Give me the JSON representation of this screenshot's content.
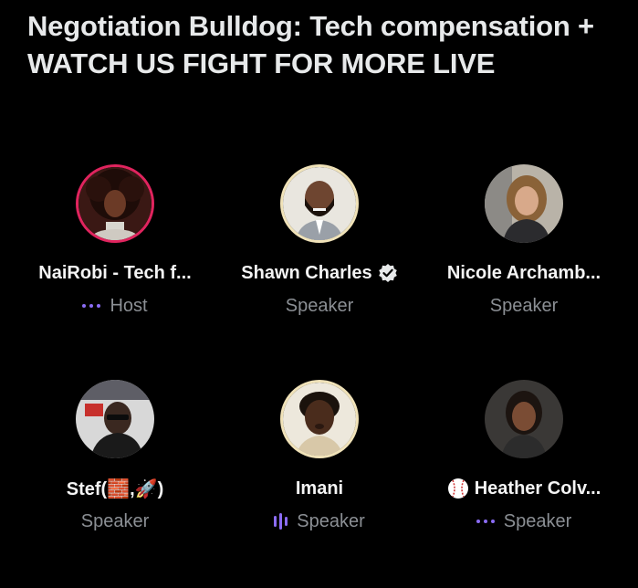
{
  "space": {
    "title": "Negotiation Bulldog: Tech compensation + WATCH US FIGHT FOR MORE LIVE"
  },
  "participants": [
    {
      "name": "NaiRobi - Tech f...",
      "role": "Host",
      "ring_color": "#e0245e",
      "indicator": "dots-icon"
    },
    {
      "name": "Shawn Charles",
      "role": "Speaker",
      "ring_color": "#f0e2b8",
      "badge": "verified-badge-icon"
    },
    {
      "name": "Nicole Archamb...",
      "role": "Speaker"
    },
    {
      "name": "Stef(🧱,🚀)",
      "role": "Speaker"
    },
    {
      "name": "Imani",
      "role": "Speaker",
      "ring_color": "#f0e2b8",
      "indicator": "speaking-bars-icon"
    },
    {
      "name": "Heather Colv...",
      "role": "Speaker",
      "prefix_icon": "baseball-icon",
      "indicator": "dots-icon"
    }
  ],
  "colors": {
    "background": "#000000",
    "title": "#e7e9ea",
    "role_text": "#8b8f94",
    "accent": "#8b6cf5"
  }
}
